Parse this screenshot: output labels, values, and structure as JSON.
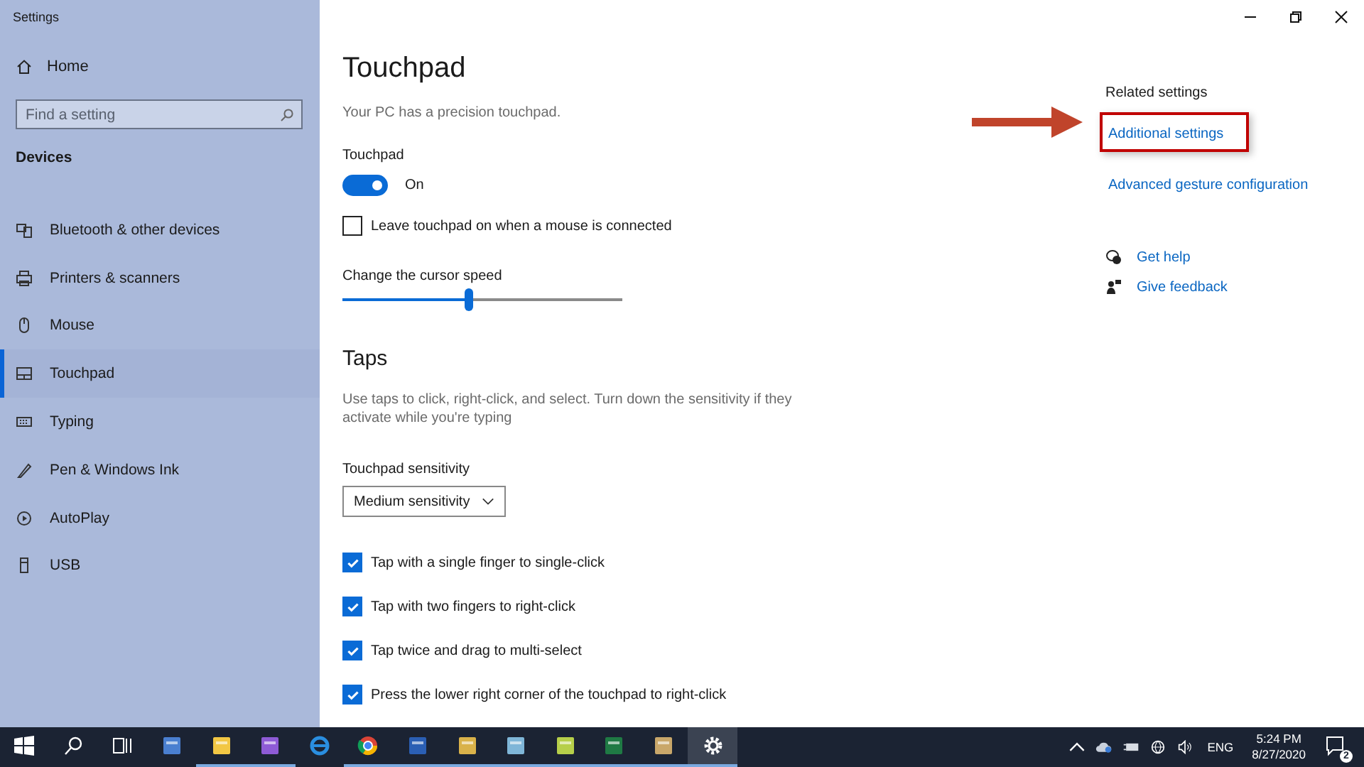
{
  "window": {
    "title": "Settings"
  },
  "sidebar": {
    "home": "Home",
    "search": {
      "placeholder": "Find a setting"
    },
    "section": "Devices",
    "items": [
      {
        "label": "Bluetooth & other devices",
        "selected": false
      },
      {
        "label": "Printers & scanners",
        "selected": false
      },
      {
        "label": "Mouse",
        "selected": false
      },
      {
        "label": "Touchpad",
        "selected": true
      },
      {
        "label": "Typing",
        "selected": false
      },
      {
        "label": "Pen & Windows Ink",
        "selected": false
      },
      {
        "label": "AutoPlay",
        "selected": false
      },
      {
        "label": "USB",
        "selected": false
      }
    ]
  },
  "main": {
    "title": "Touchpad",
    "subtitle": "Your PC has a precision touchpad.",
    "toggle": {
      "label": "Touchpad",
      "on": true,
      "state": "On"
    },
    "mouse_checkbox": {
      "label": "Leave touchpad on when a mouse is connected",
      "checked": false
    },
    "slider": {
      "label": "Change the cursor speed",
      "level": 0.45
    },
    "taps": {
      "heading": "Taps",
      "description": "Use taps to click, right-click, and select. Turn down the sensitivity if they activate while you're typing",
      "sensitivity": {
        "label": "Touchpad sensitivity",
        "value": "Medium sensitivity"
      },
      "options": [
        {
          "label": "Tap with a single finger to single-click",
          "checked": true
        },
        {
          "label": "Tap with two fingers to right-click",
          "checked": true
        },
        {
          "label": "Tap twice and drag to multi-select",
          "checked": true
        },
        {
          "label": "Press the lower right corner of the touchpad to right-click",
          "checked": true
        }
      ]
    }
  },
  "related": {
    "heading": "Related settings",
    "links": [
      {
        "label": "Additional settings",
        "highlighted": true
      },
      {
        "label": "Advanced gesture configuration",
        "highlighted": false
      }
    ],
    "help": [
      {
        "label": "Get help"
      },
      {
        "label": "Give feedback"
      }
    ]
  },
  "taskbar": {
    "apps": [
      {
        "running": false,
        "active": false
      },
      {
        "running": false,
        "active": false
      },
      {
        "running": false,
        "active": false
      },
      {
        "running": false,
        "active": false
      },
      {
        "running": true,
        "active": false
      },
      {
        "running": true,
        "active": false
      },
      {
        "running": false,
        "active": false
      },
      {
        "running": true,
        "active": false
      },
      {
        "running": true,
        "active": false
      },
      {
        "running": true,
        "active": false
      },
      {
        "running": true,
        "active": false
      },
      {
        "running": true,
        "active": false
      },
      {
        "running": true,
        "active": false
      },
      {
        "running": true,
        "active": false
      },
      {
        "running": true,
        "active": true
      }
    ],
    "language": "ENG",
    "time": "5:24 PM",
    "date": "8/27/2020",
    "notifications": "2"
  }
}
